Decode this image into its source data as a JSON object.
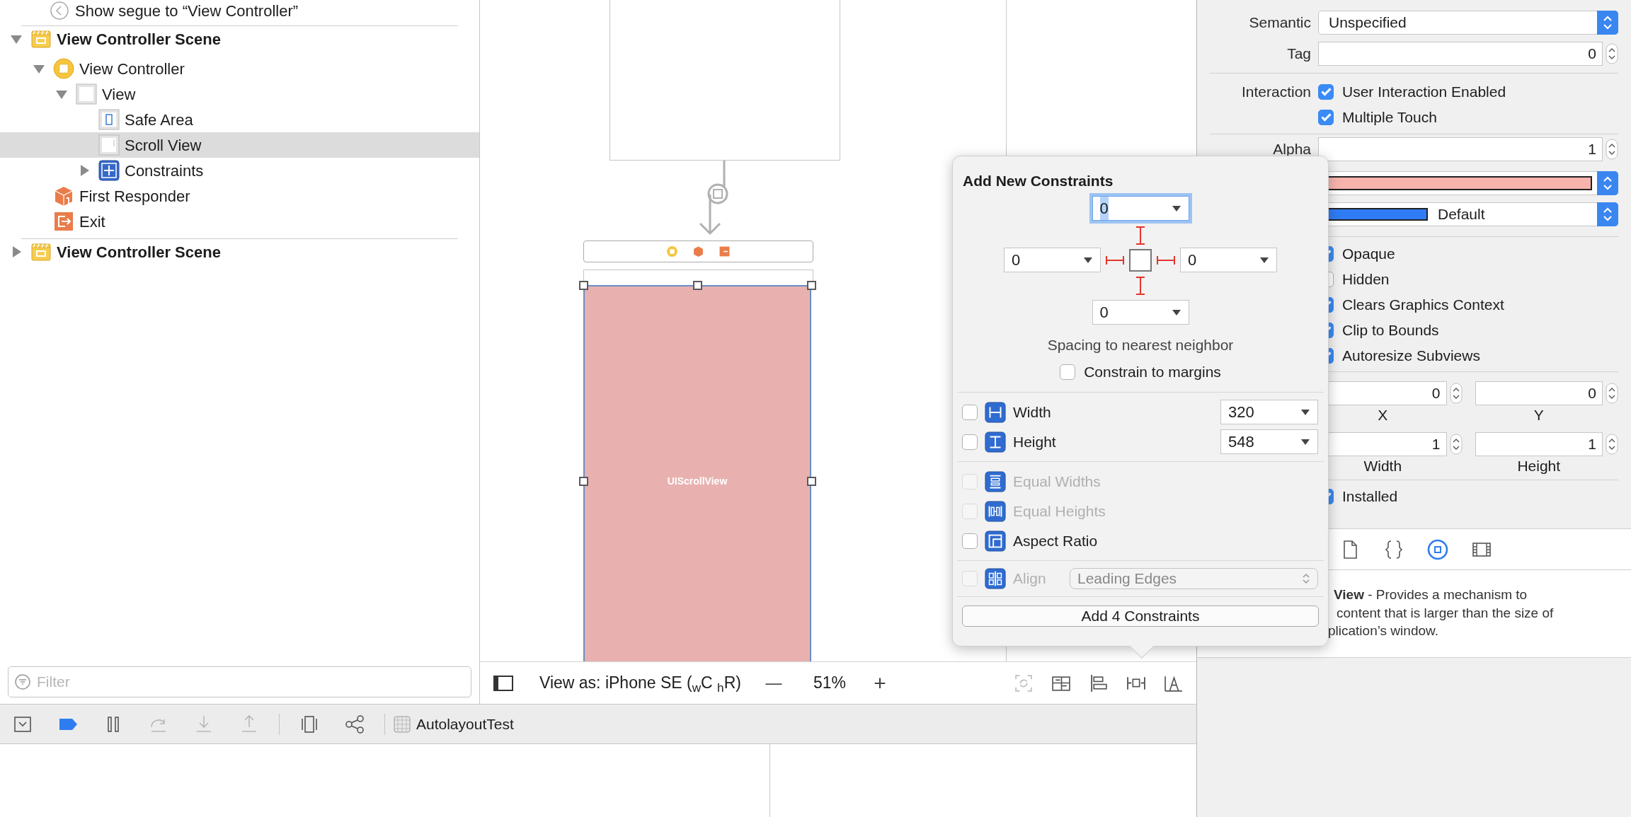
{
  "outline": {
    "segue": "Show segue to “View Controller”",
    "items": [
      {
        "label": "View Controller Scene",
        "kind": "scene",
        "expanded": true,
        "selected": false,
        "children": [
          {
            "label": "View Controller",
            "kind": "controller",
            "expanded": true,
            "selected": false,
            "children": [
              {
                "label": "View",
                "kind": "view",
                "expanded": true,
                "selected": false,
                "children": [
                  {
                    "label": "Safe Area",
                    "kind": "safe-area",
                    "selected": false
                  },
                  {
                    "label": "Scroll View",
                    "kind": "scroll-view",
                    "selected": true
                  },
                  {
                    "label": "Constraints",
                    "kind": "constraints",
                    "expanded": false,
                    "selected": false
                  }
                ]
              }
            ]
          },
          {
            "label": "First Responder",
            "kind": "responder",
            "selected": false
          },
          {
            "label": "Exit",
            "kind": "exit",
            "selected": false
          }
        ]
      },
      {
        "label": "View Controller Scene",
        "kind": "scene",
        "expanded": false,
        "selected": false
      }
    ]
  },
  "filter": {
    "placeholder": "Filter"
  },
  "canvas": {
    "view_label": "UIScrollView"
  },
  "canvas_bar": {
    "view_as": "View as: iPhone SE ($_{w}$C $_{h}$R)",
    "zoom_out": "—",
    "zoom": "51%",
    "zoom_in": "+",
    "tools": [
      {
        "kind": "update-frames",
        "disabled": true
      },
      {
        "kind": "embed",
        "disabled": false
      },
      {
        "kind": "align",
        "disabled": false
      },
      {
        "kind": "pin",
        "disabled": false
      },
      {
        "kind": "resolve",
        "disabled": false
      }
    ]
  },
  "debug_bar": {
    "buttons": [
      {
        "kind": "console",
        "disabled": false
      },
      {
        "kind": "breakpoints",
        "disabled": false
      },
      {
        "kind": "pause",
        "disabled": false
      },
      {
        "kind": "step-over",
        "disabled": true
      },
      {
        "kind": "step-into",
        "disabled": true
      },
      {
        "kind": "step-out",
        "disabled": true
      },
      {
        "kind": "view-debugger",
        "disabled": false
      },
      {
        "kind": "memory-graph",
        "disabled": false
      }
    ],
    "target": "AutolayoutTest"
  },
  "inspector": {
    "semantic": {
      "label": "Semantic",
      "value": "Unspecified"
    },
    "tag": {
      "label": "Tag",
      "value": "0"
    },
    "interaction": {
      "label": "Interaction",
      "options": [
        {
          "label": "User Interaction Enabled",
          "checked": true
        },
        {
          "label": "Multiple Touch",
          "checked": true
        }
      ]
    },
    "alpha": {
      "label": "Alpha",
      "value": "1"
    },
    "background": {
      "color": "#f8b3ad"
    },
    "tint": {
      "color": "#2f7cf6",
      "value": "Default"
    },
    "drawing": [
      {
        "label": "Opaque",
        "checked": true
      },
      {
        "label": "Hidden",
        "checked": false
      },
      {
        "label": "Clears Graphics Context",
        "checked": true
      },
      {
        "label": "Clip to Bounds",
        "checked": true
      },
      {
        "label": "Autoresize Subviews",
        "checked": true
      }
    ],
    "stretching": [
      {
        "label": "X",
        "value": "0"
      },
      {
        "label": "Y",
        "value": "0"
      },
      {
        "label": "Width",
        "value": "1"
      },
      {
        "label": "Height",
        "value": "1"
      }
    ],
    "installed": {
      "label": "Installed",
      "checked": true
    },
    "library_tabs": [
      {
        "kind": "file",
        "selected": false
      },
      {
        "kind": "code",
        "selected": false
      },
      {
        "kind": "object",
        "selected": true
      },
      {
        "kind": "media",
        "selected": false
      }
    ],
    "description": [
      "**View** - Provides a mechanism to",
      "content that is larger than the size of",
      "plication’s window."
    ]
  },
  "popover": {
    "title": "Add New Constraints",
    "spacing": {
      "top": {
        "value": "0",
        "focused": true
      },
      "left": {
        "value": "0",
        "focused": false
      },
      "right": {
        "value": "0",
        "focused": false
      },
      "bottom": {
        "value": "0",
        "focused": false
      }
    },
    "spacing_label": "Spacing to nearest neighbor",
    "margins": {
      "label": "Constrain to margins",
      "checked": false
    },
    "groups": [
      [
        {
          "kind": "width",
          "label": "Width",
          "checked": false,
          "disabled": false,
          "value": "320"
        },
        {
          "kind": "height",
          "label": "Height",
          "checked": false,
          "disabled": false,
          "value": "548"
        }
      ],
      [
        {
          "kind": "equal-widths",
          "label": "Equal Widths",
          "checked": false,
          "disabled": true
        },
        {
          "kind": "equal-heights",
          "label": "Equal Heights",
          "checked": false,
          "disabled": true
        },
        {
          "kind": "aspect-ratio",
          "label": "Aspect Ratio",
          "checked": false,
          "disabled": false
        }
      ],
      [
        {
          "kind": "align",
          "label": "Align",
          "checked": false,
          "disabled": true,
          "value": "Leading Edges"
        }
      ]
    ],
    "button": "Add 4 Constraints"
  }
}
